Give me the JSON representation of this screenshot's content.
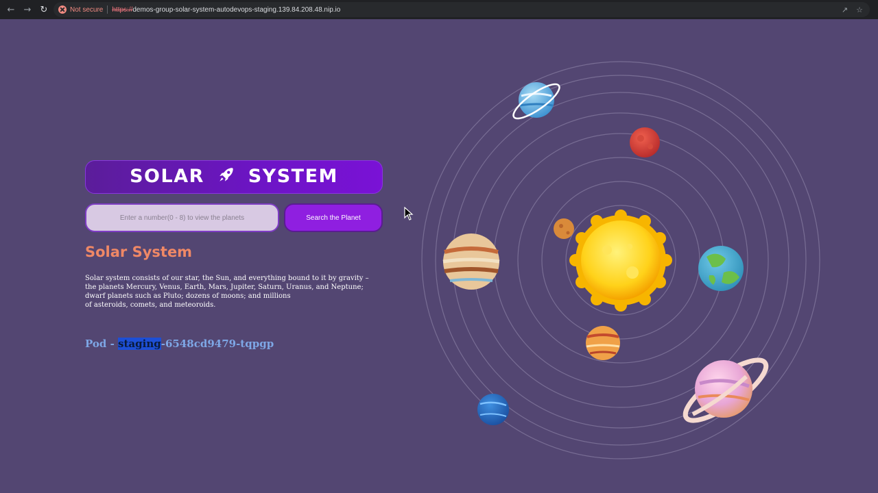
{
  "browser": {
    "security_label": "Not secure",
    "url_scheme": "https://",
    "url_rest": "demos-group-solar-system-autodevops-staging.139.84.208.48.nip.io"
  },
  "page": {
    "title_left": "SOLAR",
    "title_right": "SYSTEM",
    "search": {
      "placeholder": "Enter a number(0 - 8) to view the planets",
      "button_label": "Search the Planet"
    },
    "heading": "Solar System",
    "description_lines": [
      "Solar system consists of our star, the Sun, and everything bound to it by gravity –",
      "the planets Mercury, Venus, Earth, Mars, Jupiter, Saturn, Uranus, and Neptune;",
      "dwarf planets such as Pluto; dozens of moons; and millions",
      "of asteroids, comets, and meteoroids."
    ],
    "pod": {
      "prefix": "Pod - ",
      "highlighted": "staging",
      "suffix": "-6548cd9479-tqpgp"
    }
  },
  "colors": {
    "background": "#534672",
    "banner": "#6d14c6",
    "button": "#8f1fe0",
    "heading": "#ef8866",
    "pod_text": "#7ea7e6"
  },
  "icons": [
    "back-arrow-icon",
    "forward-arrow-icon",
    "reload-icon",
    "not-secure-icon",
    "share-icon",
    "bookmark-star-icon",
    "rocket-icon",
    "mouse-cursor-icon"
  ]
}
